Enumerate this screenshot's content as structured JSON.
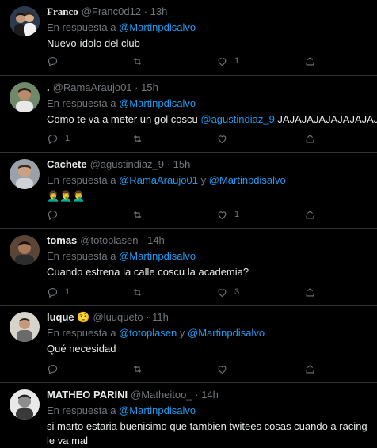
{
  "tweets": [
    {
      "name": "Franco",
      "handle": "@Franc0d12",
      "sep": "·",
      "time": "13h",
      "reply_prefix": "En respuesta a",
      "mentions": [
        "@Martinpdisalvo"
      ],
      "mention_joiner": "",
      "text_mentions": "",
      "text": "Nuevo ídolo del club",
      "counts": {
        "reply": "",
        "retweet": "",
        "like": "1",
        "share": ""
      }
    },
    {
      "name": ".",
      "handle": "@RamaAraujo01",
      "sep": "·",
      "time": "15h",
      "reply_prefix": "En respuesta a",
      "mentions": [
        "@Martinpdisalvo"
      ],
      "mention_joiner": "",
      "text_pre": "Como te va a meter un gol coscu ",
      "text_mention": "@agustindiaz_9",
      "text_post": " JAJAJAJAJAJAJAJAJAJ",
      "counts": {
        "reply": "1",
        "retweet": "",
        "like": "",
        "share": ""
      }
    },
    {
      "name": "Cachete",
      "handle": "@agustindiaz_9",
      "sep": "·",
      "time": "15h",
      "reply_prefix": "En respuesta a",
      "mentions": [
        "@RamaAraujo01",
        "@Martinpdisalvo"
      ],
      "mention_joiner": "y",
      "text": "🤦‍♂️🤦‍♂️🤦‍♂️",
      "counts": {
        "reply": "",
        "retweet": "",
        "like": "1",
        "share": ""
      }
    },
    {
      "name": "tomas",
      "handle": "@totoplasen",
      "sep": "·",
      "time": "14h",
      "reply_prefix": "En respuesta a",
      "mentions": [
        "@Martinpdisalvo"
      ],
      "mention_joiner": "",
      "text": "Cuando estrena la calle coscu la academia?",
      "counts": {
        "reply": "1",
        "retweet": "",
        "like": "3",
        "share": ""
      }
    },
    {
      "name": "luque",
      "name_emoji": "🤨",
      "handle": "@luuqueto",
      "sep": "·",
      "time": "11h",
      "reply_prefix": "En respuesta a",
      "mentions": [
        "@totoplasen",
        "@Martinpdisalvo"
      ],
      "mention_joiner": "y",
      "text": "Qué necesidad",
      "counts": {
        "reply": "",
        "retweet": "",
        "like": "",
        "share": ""
      }
    },
    {
      "name": "MATHEO PARINI",
      "handle": "@Matheitoo_",
      "sep": "·",
      "time": "14h",
      "reply_prefix": "En respuesta a",
      "mentions": [
        "@Martinpdisalvo"
      ],
      "mention_joiner": "",
      "text": "si marto estaria buenisimo que tambien twitees cosas cuando a racing le va mal"
    }
  ],
  "colors": {
    "background": "#000000",
    "text": "#e7e9ea",
    "muted": "#71767b",
    "link": "#1d9bf0",
    "divider": "#2f3336"
  },
  "icons": {
    "reply": "reply-icon",
    "retweet": "retweet-icon",
    "like": "heart-icon",
    "share": "share-icon"
  }
}
